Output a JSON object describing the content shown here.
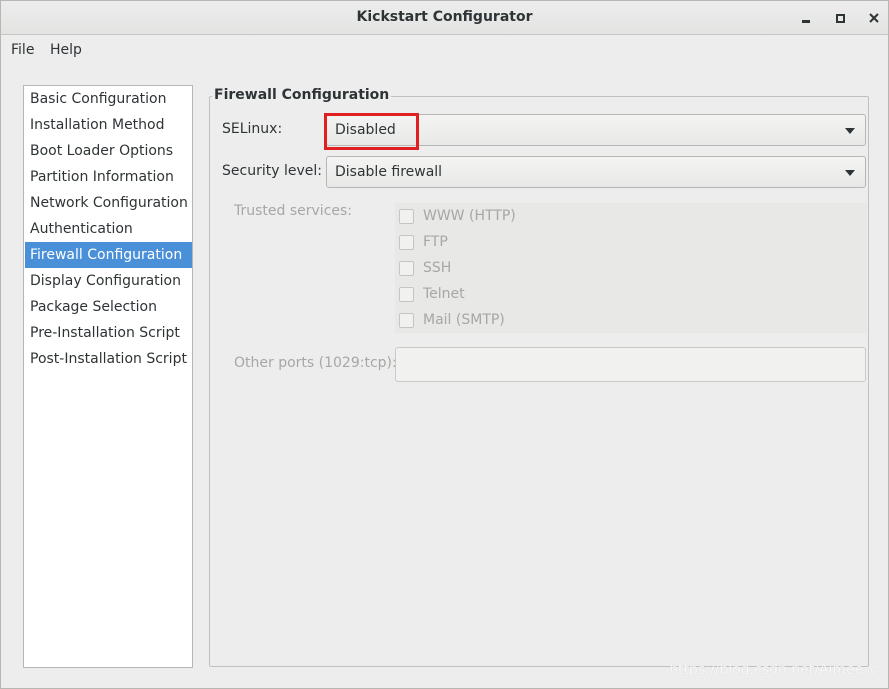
{
  "window": {
    "title": "Kickstart Configurator"
  },
  "menubar": {
    "file": "File",
    "help": "Help"
  },
  "sidebar": {
    "items": [
      {
        "label": "Basic Configuration"
      },
      {
        "label": "Installation Method"
      },
      {
        "label": "Boot Loader Options"
      },
      {
        "label": "Partition Information"
      },
      {
        "label": "Network Configuration"
      },
      {
        "label": "Authentication"
      },
      {
        "label": "Firewall Configuration"
      },
      {
        "label": "Display Configuration"
      },
      {
        "label": "Package Selection"
      },
      {
        "label": "Pre-Installation Script"
      },
      {
        "label": "Post-Installation Script"
      }
    ],
    "selected": "Firewall Configuration"
  },
  "firewall": {
    "section_title": "Firewall Configuration",
    "selinux_label": "SELinux:",
    "selinux_value": "Disabled",
    "security_label": "Security level:",
    "security_value": "Disable firewall",
    "trusted_label": "Trusted services:",
    "services": [
      {
        "label": "WWW (HTTP)",
        "checked": false
      },
      {
        "label": "FTP",
        "checked": false
      },
      {
        "label": "SSH",
        "checked": false
      },
      {
        "label": "Telnet",
        "checked": false
      },
      {
        "label": "Mail (SMTP)",
        "checked": false
      }
    ],
    "other_ports_label": "Other ports (1029:tcp):",
    "other_ports_value": ""
  },
  "watermark": "https://blog.csdn.net/Aimee_c",
  "colors": {
    "selection": "#4a90d9",
    "highlight_box": "#e02020"
  }
}
